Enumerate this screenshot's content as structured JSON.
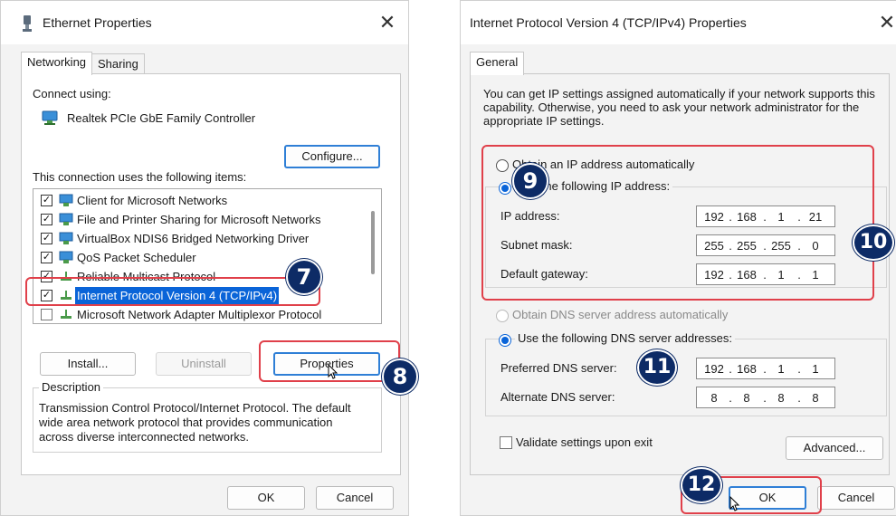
{
  "dialog1": {
    "title": "Ethernet Properties",
    "close": "✕",
    "tabs": [
      "Networking",
      "Sharing"
    ],
    "connect_using_label": "Connect using:",
    "adapter_name": "Realtek PCIe GbE Family Controller",
    "configure_button": "Configure...",
    "items_label": "This connection uses the following items:",
    "items": [
      {
        "label": "Client for Microsoft Networks",
        "checked": true
      },
      {
        "label": "File and Printer Sharing for Microsoft Networks",
        "checked": true
      },
      {
        "label": "VirtualBox NDIS6 Bridged Networking Driver",
        "checked": true
      },
      {
        "label": "QoS Packet Scheduler",
        "checked": true
      },
      {
        "label": "Reliable Multicast Protocol",
        "checked": true
      },
      {
        "label": "Internet Protocol Version 4 (TCP/IPv4)",
        "checked": true
      },
      {
        "label": "Microsoft Network Adapter Multiplexor Protocol",
        "checked": false
      }
    ],
    "install_button": "Install...",
    "uninstall_button": "Uninstall",
    "properties_button": "Properties",
    "description_title": "Description",
    "description_text": "Transmission Control Protocol/Internet Protocol. The default wide area network protocol that provides communication across diverse interconnected networks.",
    "ok_button": "OK",
    "cancel_button": "Cancel"
  },
  "dialog2": {
    "title": "Internet Protocol Version 4 (TCP/IPv4) Properties",
    "close": "✕",
    "tab": "General",
    "intro_text": "You can get IP settings assigned automatically if your network supports this capability. Otherwise, you need to ask your network administrator for the appropriate IP settings.",
    "obtain_ip_auto": "Obtain an IP address automatically",
    "use_following_ip": "Use the following IP address:",
    "ip_label": "IP address:",
    "ip_value": [
      "192",
      "168",
      "1",
      "21"
    ],
    "subnet_label": "Subnet mask:",
    "subnet_value": [
      "255",
      "255",
      "255",
      "0"
    ],
    "gateway_label": "Default gateway:",
    "gateway_value": [
      "192",
      "168",
      "1",
      "1"
    ],
    "obtain_dns_auto": "Obtain DNS server address automatically",
    "use_following_dns": "Use the following DNS server addresses:",
    "preferred_dns_label": "Preferred DNS server:",
    "preferred_dns_value": [
      "192",
      "168",
      "1",
      "1"
    ],
    "alternate_dns_label": "Alternate DNS server:",
    "alternate_dns_value": [
      "8",
      "8",
      "8",
      "8"
    ],
    "validate_label": "Validate settings upon exit",
    "advanced_button": "Advanced...",
    "ok_button": "OK",
    "cancel_button": "Cancel"
  },
  "callouts": {
    "step7": "7",
    "step8": "8",
    "step9": "9",
    "step10": "10",
    "step11": "11",
    "step12": "12"
  },
  "colors": {
    "accent": "#0a64d8",
    "badge": "#0d2b66",
    "highlight_box": "#e0404a"
  }
}
